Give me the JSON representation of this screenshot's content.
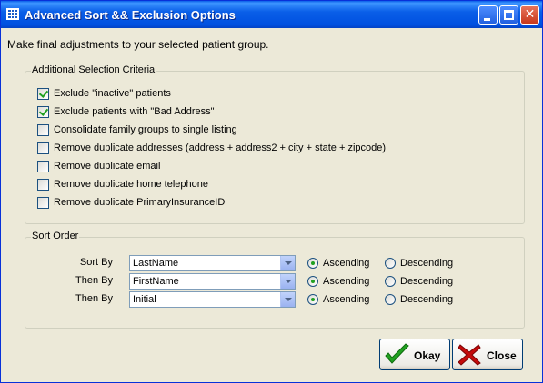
{
  "window": {
    "title": "Advanced Sort && Exclusion Options"
  },
  "intro_text": "Make final adjustments to your selected patient group.",
  "criteria": {
    "legend": "Additional Selection Criteria",
    "items": [
      {
        "label": "Exclude \"inactive\" patients",
        "checked": true
      },
      {
        "label": "Exclude patients with \"Bad Address\"",
        "checked": true
      },
      {
        "label": "Consolidate family groups to single listing",
        "checked": false
      },
      {
        "label": "Remove duplicate addresses (address + address2 + city + state + zipcode)",
        "checked": false
      },
      {
        "label": "Remove duplicate email",
        "checked": false
      },
      {
        "label": "Remove duplicate home telephone",
        "checked": false
      },
      {
        "label": "Remove duplicate PrimaryInsuranceID",
        "checked": false
      }
    ]
  },
  "sort": {
    "legend": "Sort Order",
    "ascending_label": "Ascending",
    "descending_label": "Descending",
    "rows": [
      {
        "label": "Sort By",
        "value": "LastName",
        "order": "Ascending"
      },
      {
        "label": "Then By",
        "value": "FirstName",
        "order": "Ascending"
      },
      {
        "label": "Then By",
        "value": "Initial",
        "order": "Ascending"
      }
    ]
  },
  "buttons": {
    "okay": "Okay",
    "close": "Close"
  },
  "colors": {
    "titlebar": "#0a5fe8",
    "dialog_bg": "#ece9d8",
    "check_green": "#21a121",
    "close_red": "#c40b0b"
  }
}
